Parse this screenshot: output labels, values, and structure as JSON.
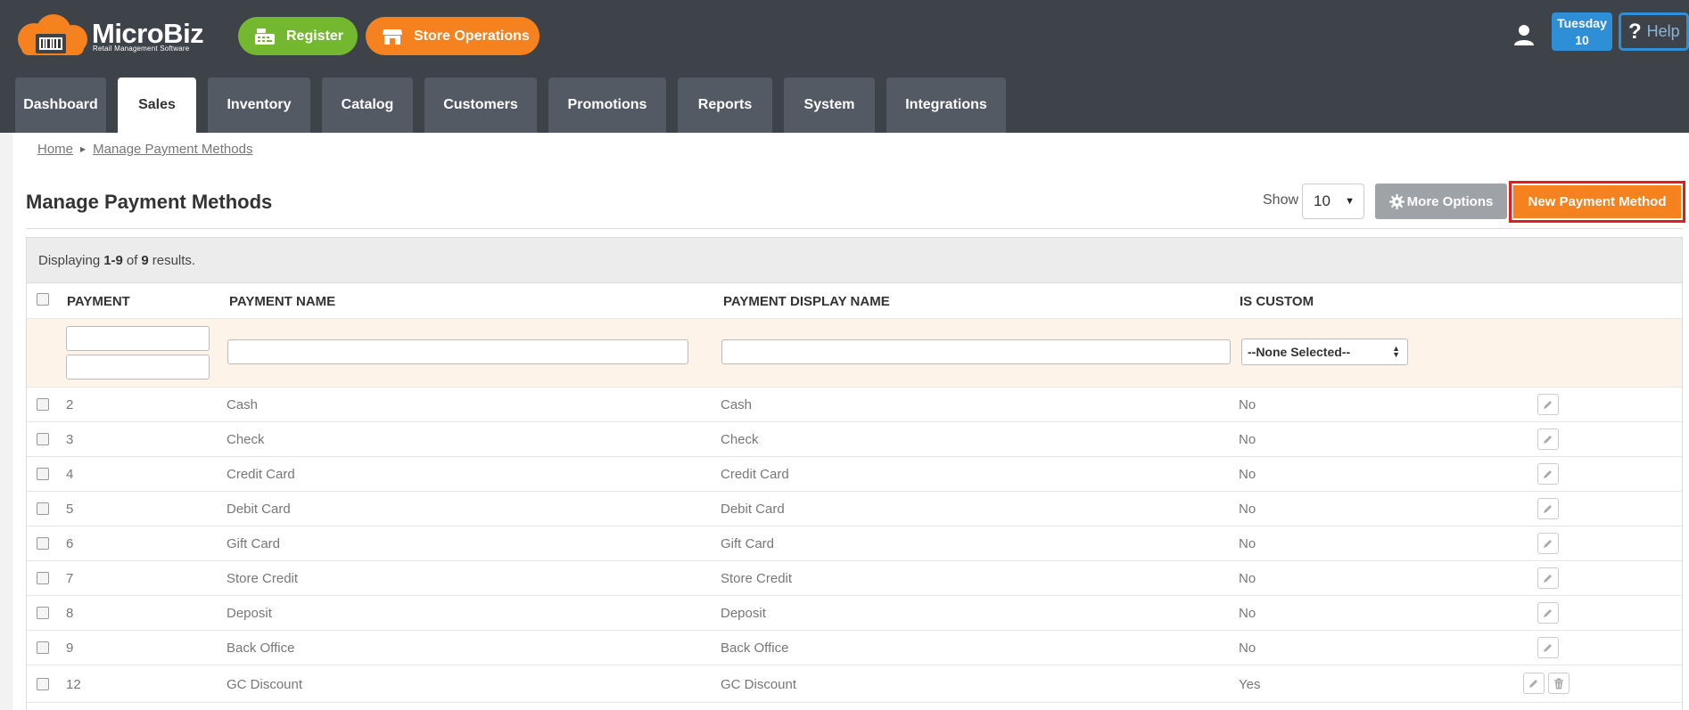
{
  "app": {
    "logo_name": "MicroBiz",
    "logo_tagline": "Retail Management Software"
  },
  "header": {
    "register_label": "Register",
    "store_ops_label": "Store Operations",
    "date_day": "Tuesday",
    "date_num": "10",
    "help_label": "Help"
  },
  "tabs": [
    {
      "label": "Dashboard"
    },
    {
      "label": "Sales"
    },
    {
      "label": "Inventory"
    },
    {
      "label": "Catalog"
    },
    {
      "label": "Customers"
    },
    {
      "label": "Promotions"
    },
    {
      "label": "Reports"
    },
    {
      "label": "System"
    },
    {
      "label": "Integrations"
    }
  ],
  "breadcrumb": {
    "home": "Home",
    "current": "Manage Payment Methods"
  },
  "page": {
    "title": "Manage Payment Methods",
    "show_label": "Show",
    "show_value": "10",
    "more_options": "More Options",
    "new_button": "New Payment Method"
  },
  "summary": {
    "prefix": "Displaying",
    "range": "1-9",
    "of": "of",
    "total": "9",
    "suffix": "results."
  },
  "columns": {
    "payment": "PAYMENT",
    "payment_name": "PAYMENT NAME",
    "display_name": "PAYMENT DISPLAY NAME",
    "is_custom": "IS CUSTOM"
  },
  "filters": {
    "is_custom_selected": "--None Selected--"
  },
  "rows": [
    {
      "id": "2",
      "name": "Cash",
      "display": "Cash",
      "custom": "No"
    },
    {
      "id": "3",
      "name": "Check",
      "display": "Check",
      "custom": "No"
    },
    {
      "id": "4",
      "name": "Credit Card",
      "display": "Credit Card",
      "custom": "No"
    },
    {
      "id": "5",
      "name": "Debit Card",
      "display": "Debit Card",
      "custom": "No"
    },
    {
      "id": "6",
      "name": "Gift Card",
      "display": "Gift Card",
      "custom": "No"
    },
    {
      "id": "7",
      "name": "Store Credit",
      "display": "Store Credit",
      "custom": "No"
    },
    {
      "id": "8",
      "name": "Deposit",
      "display": "Deposit",
      "custom": "No"
    },
    {
      "id": "9",
      "name": "Back Office",
      "display": "Back Office",
      "custom": "No"
    },
    {
      "id": "12",
      "name": "GC Discount",
      "display": "GC Discount",
      "custom": "Yes"
    }
  ],
  "colors": {
    "header_bg": "#3e434a",
    "tab_bg": "#535a63",
    "register_green": "#74b830",
    "brand_orange": "#f5821f",
    "date_blue": "#2e8fd6",
    "highlight_red": "#e31c1c",
    "filter_row_bg": "#fdf3e8"
  }
}
